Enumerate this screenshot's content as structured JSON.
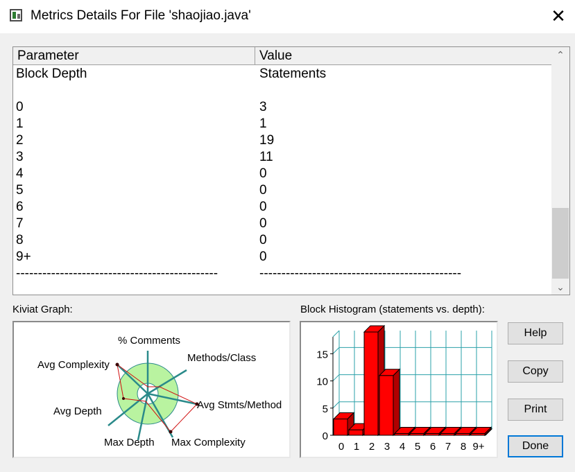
{
  "window": {
    "title": "Metrics Details For File 'shaojiao.java'"
  },
  "table": {
    "headers": [
      "Parameter",
      "Value"
    ],
    "rows": [
      [
        "Block Depth",
        "Statements"
      ],
      [
        "",
        ""
      ],
      [
        "0",
        "3"
      ],
      [
        "1",
        "1"
      ],
      [
        "2",
        "19"
      ],
      [
        "3",
        "11"
      ],
      [
        "4",
        "0"
      ],
      [
        "5",
        "0"
      ],
      [
        "6",
        "0"
      ],
      [
        "7",
        "0"
      ],
      [
        "8",
        "0"
      ],
      [
        "9+",
        "0"
      ],
      [
        "----------------------------------------------",
        "----------------------------------------------"
      ]
    ]
  },
  "kiviat": {
    "label": "Kiviat Graph:",
    "axes": [
      "% Comments",
      "Methods/Class",
      "Avg Stmts/Method",
      "Max Complexity",
      "Max Depth",
      "Avg Depth",
      "Avg Complexity"
    ],
    "colors": {
      "ring": "#b9f3a0",
      "spokes": "#2a8a8a",
      "polygon": "#d01010"
    }
  },
  "histogram": {
    "label": "Block Histogram (statements vs. depth):",
    "colors": {
      "bar": "#ff0000",
      "grid": "#2aa0a8"
    }
  },
  "chart_data": {
    "type": "bar",
    "categories": [
      "0",
      "1",
      "2",
      "3",
      "4",
      "5",
      "6",
      "7",
      "8",
      "9+"
    ],
    "values": [
      3,
      1,
      19,
      11,
      0,
      0,
      0,
      0,
      0,
      0
    ],
    "yticks": [
      "0",
      "5",
      "10",
      "15"
    ],
    "ylim": [
      0,
      19
    ]
  },
  "buttons": {
    "help": "Help",
    "copy": "Copy",
    "print": "Print",
    "done": "Done"
  }
}
